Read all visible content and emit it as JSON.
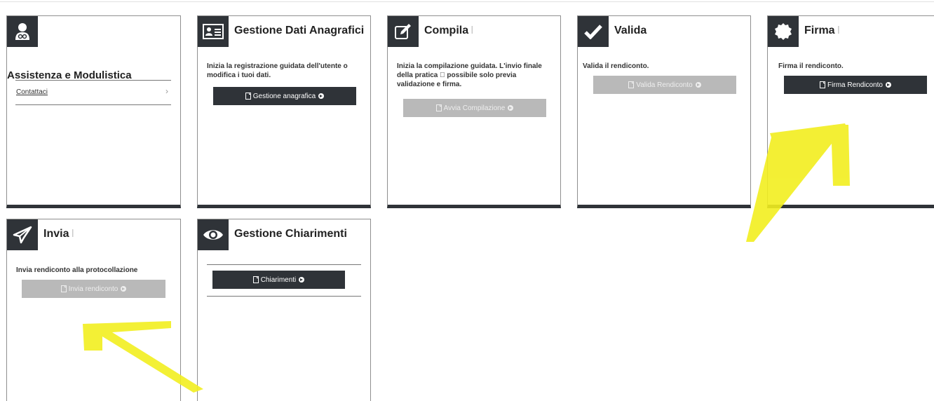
{
  "assistenza": {
    "title": "Assistenza e Modulistica",
    "link": "Contattaci",
    "chevron": "›",
    "icon": "doctor-icon"
  },
  "cards": {
    "gestione_dati": {
      "title": "Gestione Dati Anagrafici",
      "description": "Inizia la registrazione guidata dell'utente o modifica i tuoi dati.",
      "button": "Gestione anagrafica",
      "button_enabled": true,
      "icon": "id-card-icon"
    },
    "compila": {
      "title": "Compila",
      "title_mark": "I",
      "description": "Inizia la compilazione guidata. L'invio finale della pratica \u0000 possibile solo previa validazione e firma.",
      "button": "Avvia Compilazione",
      "button_enabled": false,
      "icon": "edit-icon"
    },
    "valida": {
      "title": "Valida",
      "description": "Valida il rendiconto.",
      "button": "Valida Rendiconto",
      "button_enabled": false,
      "icon": "checkmark-icon"
    },
    "firma": {
      "title": "Firma",
      "title_mark": "I",
      "description": "Firma il rendiconto.",
      "button": "Firma Rendiconto",
      "button_enabled": true,
      "icon": "seal-icon"
    },
    "invia": {
      "title": "Invia",
      "title_mark": "I",
      "description": "Invia rendiconto alla protocollazione",
      "button": "Invia rendiconto",
      "button_enabled": false,
      "icon": "paper-plane-icon"
    },
    "chiarimenti": {
      "title": "Gestione Chiarimenti",
      "button": "Chiarimenti",
      "button_enabled": true,
      "icon": "eye-icon"
    }
  },
  "colors": {
    "dark": "#2f3338",
    "disabled": "#b9b9b9",
    "highlight": "#f2ee1f"
  }
}
